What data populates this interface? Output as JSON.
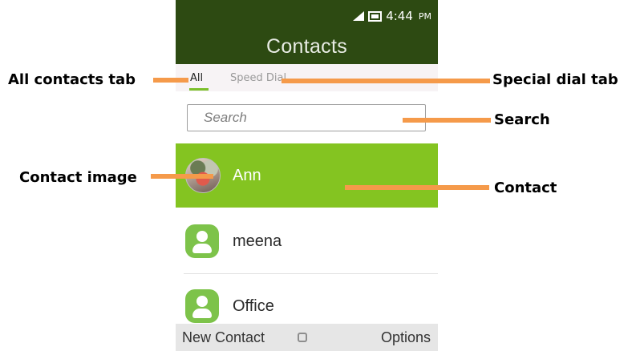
{
  "status_bar": {
    "time": "4:44",
    "ampm": "PM"
  },
  "header": {
    "title": "Contacts"
  },
  "tabs": [
    {
      "label": "All"
    },
    {
      "label": "Speed Dial"
    }
  ],
  "search": {
    "placeholder": "Search"
  },
  "contacts": [
    {
      "name": "Ann",
      "avatar": "photo"
    },
    {
      "name": "meena",
      "avatar": "default-person-icon"
    },
    {
      "name": "Office",
      "avatar": "default-person-icon"
    }
  ],
  "softkeys": {
    "left": "New Contact",
    "center": "select-icon",
    "right": "Options"
  },
  "annotations": {
    "all_tab": "All contacts tab",
    "speed_dial_tab": "Special dial tab",
    "search": "Search",
    "contact_image": "Contact image",
    "contact": "Contact"
  },
  "colors": {
    "header": "#2d4a12",
    "selected_row": "#84c421",
    "accent": "#7bbf2a",
    "callout": "#f59a4a"
  }
}
